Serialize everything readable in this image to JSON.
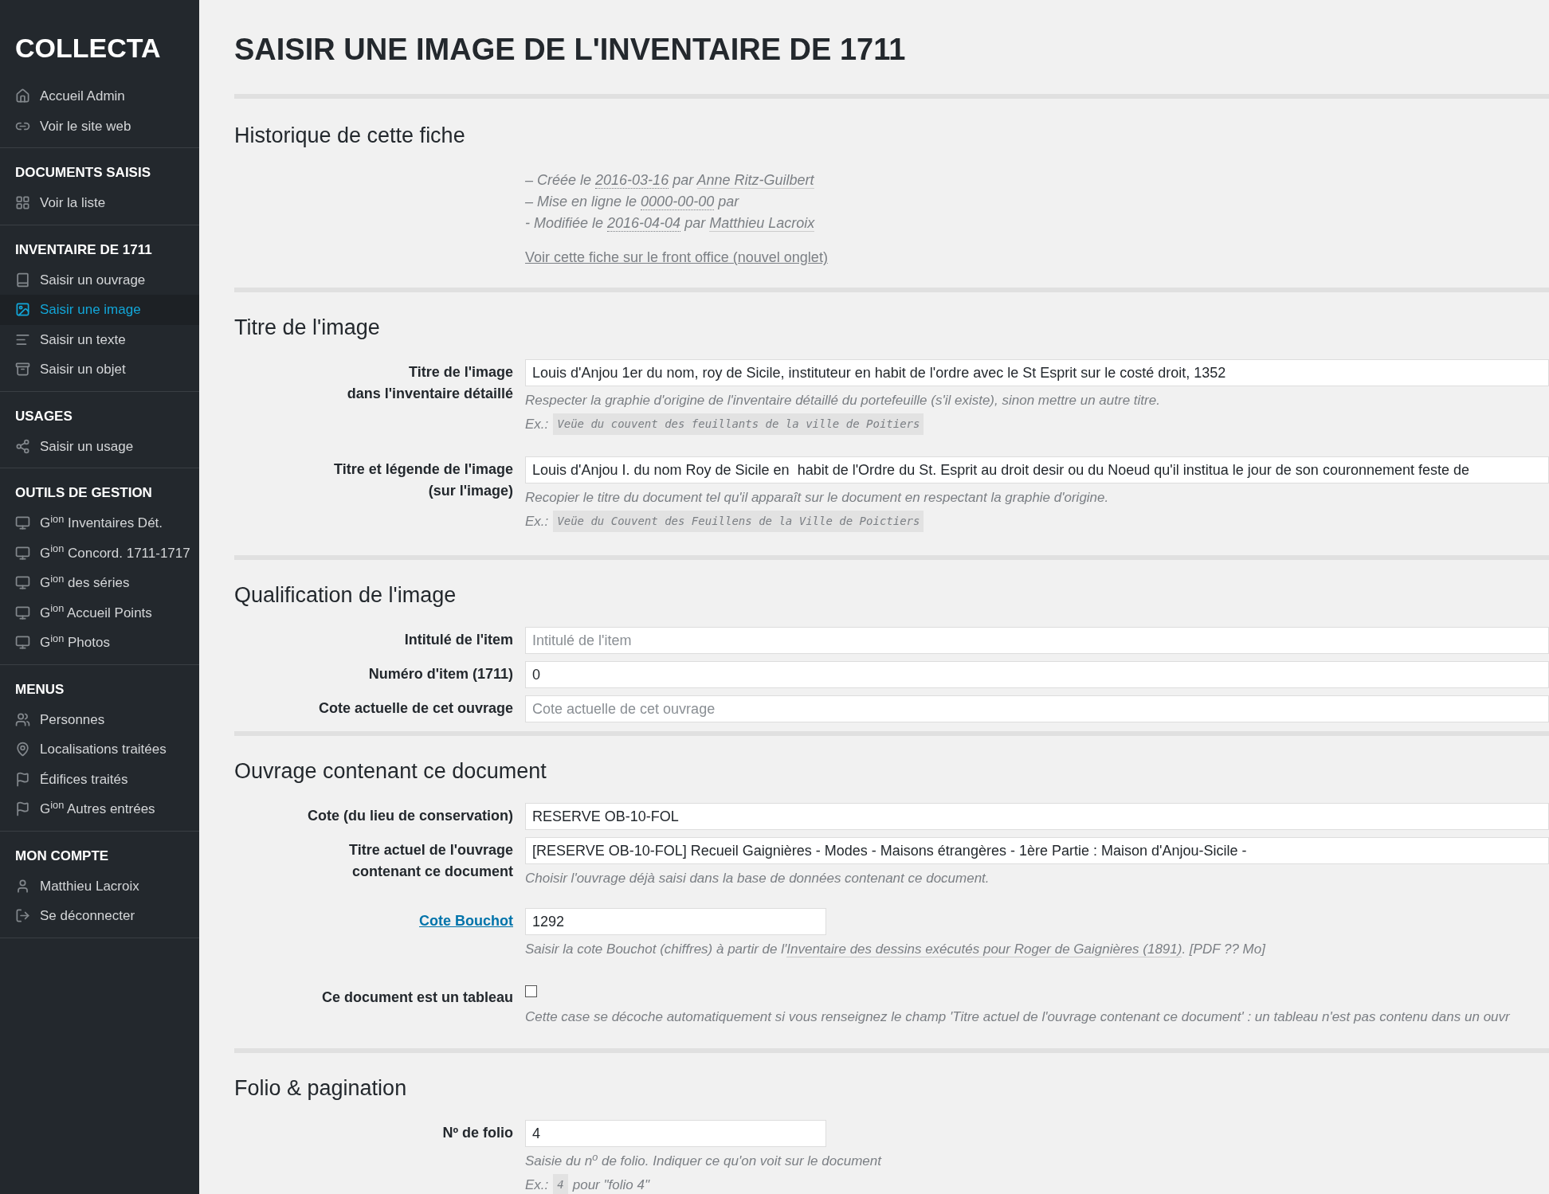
{
  "sidebar": {
    "logo": "COLLECTA",
    "groups": [
      {
        "items": [
          {
            "label": "Accueil Admin",
            "selected": false
          },
          {
            "label": "Voir le site web",
            "selected": false
          }
        ]
      },
      {
        "heading": "DOCUMENTS SAISIS",
        "items": [
          {
            "label": "Voir la liste",
            "selected": false
          }
        ]
      },
      {
        "heading": "INVENTAIRE DE 1711",
        "items": [
          {
            "label": "Saisir un ouvrage",
            "selected": false
          },
          {
            "label": "Saisir une image",
            "selected": true
          },
          {
            "label": "Saisir un texte",
            "selected": false
          },
          {
            "label": "Saisir un objet",
            "selected": false
          }
        ]
      },
      {
        "heading": "USAGES",
        "items": [
          {
            "label": "Saisir un usage",
            "selected": false
          }
        ]
      },
      {
        "heading": "OUTILS DE GESTION",
        "items": [
          {
            "label": "G$^{ion}$ Inventaires Dét.",
            "selected": false
          },
          {
            "label": "G$^{ion}$ Concord. 1711-1717",
            "selected": false
          },
          {
            "label": "G$^{ion}$ des séries",
            "selected": false
          },
          {
            "label": "G$^{ion}$ Accueil Points",
            "selected": false
          },
          {
            "label": "G$^{ion}$ Photos",
            "selected": false
          }
        ]
      },
      {
        "heading": "MENUS",
        "items": [
          {
            "label": "Personnes",
            "selected": false
          },
          {
            "label": "Localisations traitées",
            "selected": false
          },
          {
            "label": "Édifices traités",
            "selected": false
          },
          {
            "label": "G$^{ion}$ Autres entrées",
            "selected": false
          }
        ]
      },
      {
        "heading": "MON COMPTE",
        "items": [
          {
            "label": "Matthieu Lacroix",
            "selected": false
          },
          {
            "label": "Se déconnecter",
            "selected": false
          }
        ]
      }
    ]
  },
  "page_title": "SAISIR UNE IMAGE DE L'INVENTAIRE DE 1711",
  "history": {
    "title": "Historique de cette fiche",
    "lines": [
      [
        {
          "kind": "plain",
          "text": "– Créée le "
        },
        {
          "kind": "date",
          "text": "2016-03-16"
        },
        {
          "kind": "plain",
          "text": " par "
        },
        {
          "kind": "user",
          "text": "Anne Ritz-Guilbert"
        }
      ],
      [
        {
          "kind": "plain",
          "text": "– Mise en ligne le "
        },
        {
          "kind": "date",
          "text": "0000-00-00"
        },
        {
          "kind": "plain",
          "text": " par"
        }
      ],
      [
        {
          "kind": "plain",
          "text": "- Modifiée le "
        },
        {
          "kind": "date",
          "text": "2016-04-04"
        },
        {
          "kind": "plain",
          "text": " par "
        },
        {
          "kind": "user",
          "text": "Matthieu Lacroix"
        }
      ]
    ],
    "link": "Voir cette fiche sur le front office (nouvel onglet)"
  },
  "sections": [
    {
      "title": "Titre de l'image",
      "fields": [
        {
          "kind": "text",
          "label": [
            "Titre de l'image",
            "dans l'inventaire détaillé"
          ],
          "label_link": false,
          "value": "Louis d'Anjou 1er du nom, roy de Sicile, instituteur en habit de l'ordre avec le St Esprit sur le costé droit, 1352",
          "hint": [
            {
              "link": false,
              "text": "Respecter la graphie d'origine de l'inventaire détaillé du portefeuille (s'il existe), sinon mettre un autre titre."
            }
          ],
          "example_prefix": "Ex.:",
          "example": "Veüe du couvent des feuillants de la ville de Poitiers"
        },
        {
          "kind": "text",
          "label": [
            "Titre et légende de l'image",
            "(sur l'image)"
          ],
          "label_link": false,
          "value": "Louis d'Anjou I. du nom Roy de Sicile en  habit de l'Ordre du St. Esprit au droit desir ou du Noeud qu'il institua le jour de son couronnement feste de",
          "hint": [
            {
              "link": false,
              "text": "Recopier le titre du document tel qu'il apparaît sur le document en respectant la graphie d'origine."
            }
          ],
          "example_prefix": "Ex.:",
          "example": "Veüe du Couvent des Feuillens de la Ville de Poictiers"
        }
      ]
    },
    {
      "title": "Qualification de l'image",
      "fields": [
        {
          "kind": "text",
          "label": [
            "Intitulé de l'item"
          ],
          "label_link": false,
          "placeholder": "Intitulé de l'item"
        },
        {
          "kind": "text",
          "label": [
            "Numéro d'item (1711)"
          ],
          "label_link": false,
          "value": "0"
        },
        {
          "kind": "text",
          "label": [
            "Cote actuelle de cet ouvrage"
          ],
          "label_link": false,
          "placeholder": "Cote actuelle de cet ouvrage"
        }
      ]
    },
    {
      "title": "Ouvrage contenant ce document",
      "fields": [
        {
          "kind": "text",
          "label": [
            "Cote (du lieu de conservation)"
          ],
          "label_link": false,
          "value": "RESERVE OB-10-FOL"
        },
        {
          "kind": "text",
          "label": [
            "Titre actuel de l'ouvrage",
            "contenant ce document"
          ],
          "label_link": false,
          "value": "[RESERVE OB-10-FOL] Recueil Gaignières - Modes - Maisons étrangères - 1ère Partie : Maison d'Anjou-Sicile -",
          "hint": [
            {
              "link": false,
              "text": "Choisir l'ouvrage déjà saisi dans la base de données contenant ce document."
            }
          ]
        },
        {
          "kind": "short",
          "label": [
            "Cote Bouchot"
          ],
          "label_link": true,
          "value": "1292",
          "hint": [
            {
              "link": false,
              "text": "Saisir la cote Bouchot (chiffres) à partir de l'"
            },
            {
              "link": true,
              "text": "Inventaire des dessins exécutés pour Roger de Gaignières (1891)"
            },
            {
              "link": false,
              "text": ". [PDF ?? Mo]"
            }
          ]
        },
        {
          "kind": "checkbox",
          "label": [
            "Ce document est un tableau"
          ],
          "label_link": false,
          "checked": false,
          "hint": [
            {
              "link": false,
              "text": "Cette case se décoche automatiquement si vous renseignez le champ 'Titre actuel de l'ouvrage contenant ce document' : un tableau n'est pas contenu dans un ouvr"
            }
          ]
        }
      ]
    },
    {
      "title": "Folio & pagination",
      "fields": [
        {
          "kind": "short",
          "label": [
            "Nº de folio"
          ],
          "label_link": false,
          "value": "4",
          "hint": [
            {
              "link": false,
              "text": "Saisie du n$^{o}$ de folio. Indiquer ce qu'on voit sur le document"
            }
          ],
          "example_prefix": "Ex.:",
          "example": "4",
          "example_suffix": "pour \"folio 4\""
        }
      ]
    }
  ]
}
